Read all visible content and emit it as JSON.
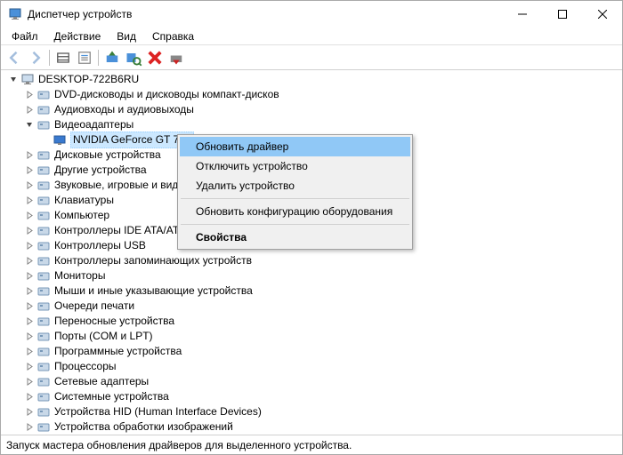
{
  "window": {
    "title": "Диспетчер устройств"
  },
  "menubar": {
    "items": [
      "Файл",
      "Действие",
      "Вид",
      "Справка"
    ]
  },
  "tree": {
    "root": "DESKTOP-722B6RU",
    "items": [
      {
        "label": "DVD-дисководы и дисководы компакт-дисков",
        "expanded": false
      },
      {
        "label": "Аудиовходы и аудиовыходы",
        "expanded": false
      },
      {
        "label": "Видеоадаптеры",
        "expanded": true,
        "children": [
          {
            "label": "NVIDIA GeForce GT 710",
            "selected": true
          }
        ]
      },
      {
        "label": "Дисковые устройства",
        "expanded": false
      },
      {
        "label": "Другие устройства",
        "expanded": false
      },
      {
        "label": "Звуковые, игровые и виде",
        "expanded": false
      },
      {
        "label": "Клавиатуры",
        "expanded": false
      },
      {
        "label": "Компьютер",
        "expanded": false
      },
      {
        "label": "Контроллеры IDE ATA/AT/",
        "expanded": false
      },
      {
        "label": "Контроллеры USB",
        "expanded": false
      },
      {
        "label": "Контроллеры запоминающих устройств",
        "expanded": false
      },
      {
        "label": "Мониторы",
        "expanded": false
      },
      {
        "label": "Мыши и иные указывающие устройства",
        "expanded": false
      },
      {
        "label": "Очереди печати",
        "expanded": false
      },
      {
        "label": "Переносные устройства",
        "expanded": false
      },
      {
        "label": "Порты (COM и LPT)",
        "expanded": false
      },
      {
        "label": "Программные устройства",
        "expanded": false
      },
      {
        "label": "Процессоры",
        "expanded": false
      },
      {
        "label": "Сетевые адаптеры",
        "expanded": false
      },
      {
        "label": "Системные устройства",
        "expanded": false
      },
      {
        "label": "Устройства HID (Human Interface Devices)",
        "expanded": false
      },
      {
        "label": "Устройства обработки изображений",
        "expanded": false
      }
    ]
  },
  "context_menu": {
    "items": [
      {
        "label": "Обновить драйвер",
        "highlight": true
      },
      {
        "label": "Отключить устройство"
      },
      {
        "label": "Удалить устройство"
      },
      {
        "sep": true
      },
      {
        "label": "Обновить конфигурацию оборудования"
      },
      {
        "sep": true
      },
      {
        "label": "Свойства",
        "bold": true
      }
    ]
  },
  "statusbar": {
    "text": "Запуск мастера обновления драйверов для выделенного устройства."
  }
}
